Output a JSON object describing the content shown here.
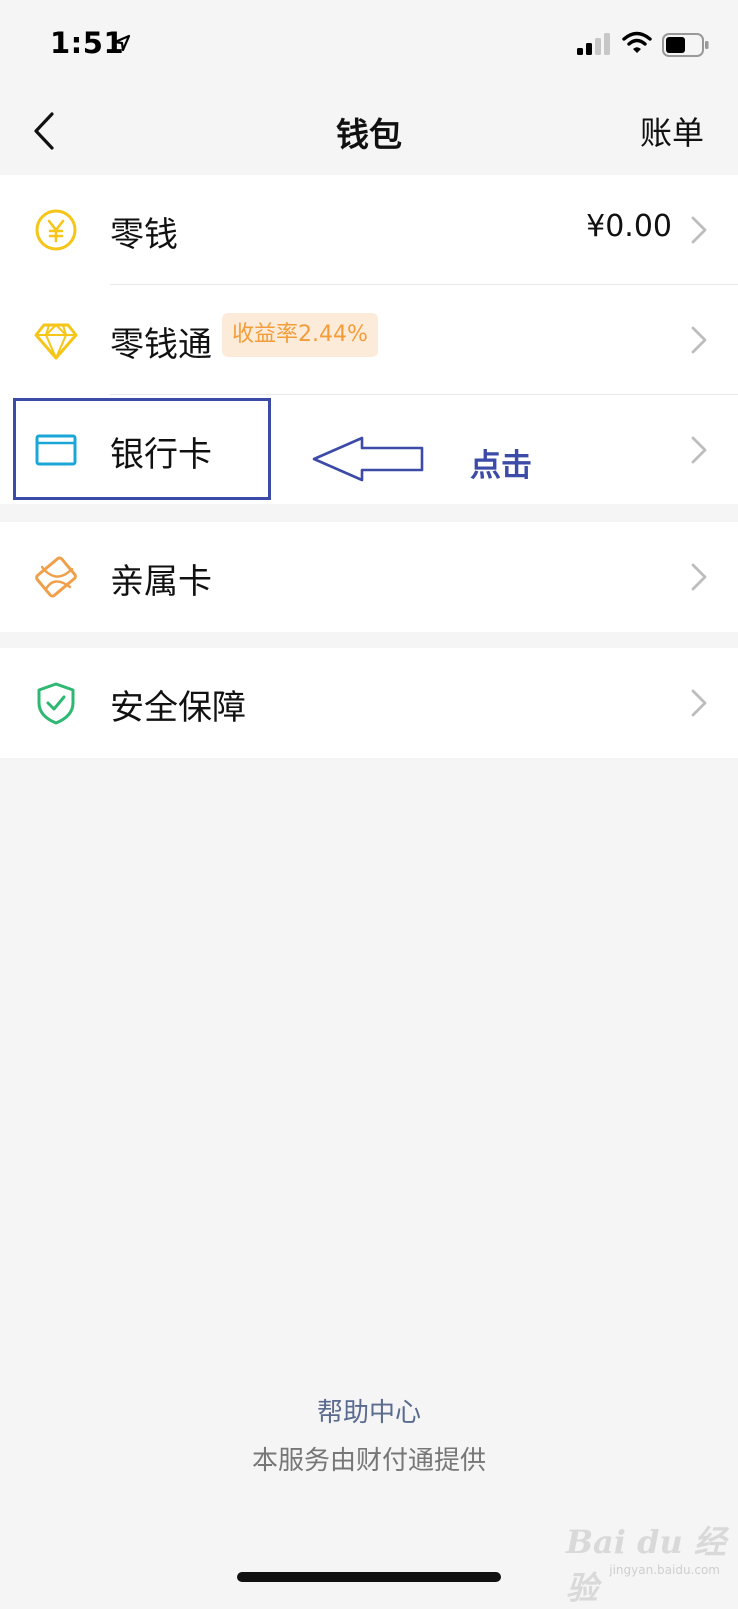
{
  "status_bar": {
    "time": "1:51"
  },
  "nav": {
    "title": "钱包",
    "right_action": "账单"
  },
  "wallet_items": [
    {
      "label": "零钱",
      "value": "¥0.00"
    },
    {
      "label": "零钱通",
      "badge": "收益率2.44%"
    },
    {
      "label": "银行卡"
    },
    {
      "label": "亲属卡"
    },
    {
      "label": "安全保障"
    }
  ],
  "annotation": {
    "text": "点击"
  },
  "footer": {
    "help": "帮助中心",
    "note": "本服务由财付通提供"
  },
  "watermark": {
    "logo": "Bai du 经验",
    "sub": "jingyan.baidu.com"
  },
  "colors": {
    "background": "#f5f5f5",
    "coin_icon": "#f5c518",
    "card_icon": "#1aa7d8",
    "family_card_icon": "#f0a04b",
    "security_icon": "#2eb872",
    "badge_bg": "#fcebd9",
    "badge_text": "#f29d3a",
    "annotation": "#3c4aa8",
    "help_link": "#5b6b8f"
  },
  "icons": [
    "location-arrow-icon",
    "signal-icon",
    "wifi-icon",
    "battery-icon",
    "back-icon",
    "yuan-coin-icon",
    "diamond-icon",
    "bank-card-icon",
    "family-card-icon",
    "shield-check-icon",
    "chevron-right-icon"
  ]
}
